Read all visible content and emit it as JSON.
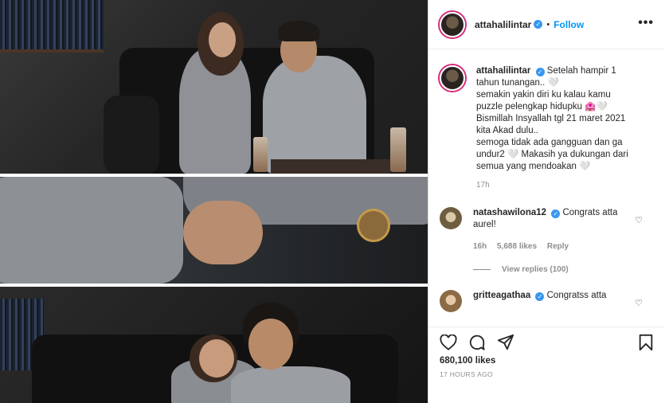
{
  "post": {
    "username": "attahalilintar",
    "follow_label": "Follow",
    "more_label": "•••",
    "separator": "•",
    "caption": {
      "username": "attahalilintar",
      "lines": [
        "Setelah hampir 1 tahun tunangan.. 🤍",
        "semakin yakin diri ku kalau kamu puzzle pelengkap hidupku 🏩🤍",
        "Bismillah Insyallah tgl 21 maret 2021 kita Akad dulu..",
        "semoga tidak ada gangguan dan ga undur2 🤍 Makasih ya dukungan dari semua yang mendoakan 🤍"
      ],
      "time": "17h"
    },
    "comments": [
      {
        "username": "natashawilona12",
        "text": "Congrats atta aurel!",
        "time": "16h",
        "likes": "5,688 likes",
        "reply": "Reply",
        "view_replies": "View replies (100)"
      },
      {
        "username": "gritteagathaa",
        "text": "Congratss atta"
      }
    ],
    "likes": "680,100 likes",
    "posted_ago": "17 HOURS AGO"
  },
  "icons": {
    "heart": "heart-icon",
    "comment": "comment-icon",
    "share": "share-icon",
    "bookmark": "bookmark-icon",
    "verified": "verified-icon"
  },
  "colors": {
    "follow": "#0095f6",
    "verified": "#3897f0",
    "muted": "#8e8e8e",
    "border": "#dbdbdb"
  }
}
